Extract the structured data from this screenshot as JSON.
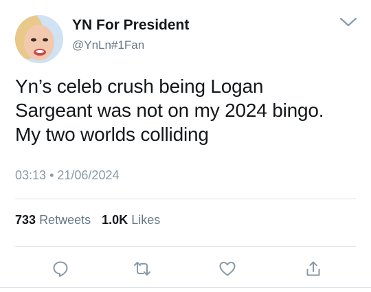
{
  "author": {
    "display_name": "YN For President",
    "handle": "@YnLn#1Fan"
  },
  "tweet": {
    "text_lines": [
      "Yn’s celeb crush being Logan",
      "Sargeant was not on my 2024 bingo.",
      "My two worlds colliding"
    ],
    "time": "03:13",
    "separator": "•",
    "date": "21/06/2024"
  },
  "stats": {
    "retweets_count": "733",
    "retweets_label": "Retweets",
    "likes_count": "1.0K",
    "likes_label": "Likes"
  },
  "actions": [
    {
      "icon": "reply-icon"
    },
    {
      "icon": "retweet-icon"
    },
    {
      "icon": "like-icon"
    },
    {
      "icon": "share-icon"
    }
  ],
  "colors": {
    "text_primary": "#14171a",
    "text_secondary": "#657786",
    "icon_gray": "#8899a6",
    "divider": "#dde3e8"
  }
}
